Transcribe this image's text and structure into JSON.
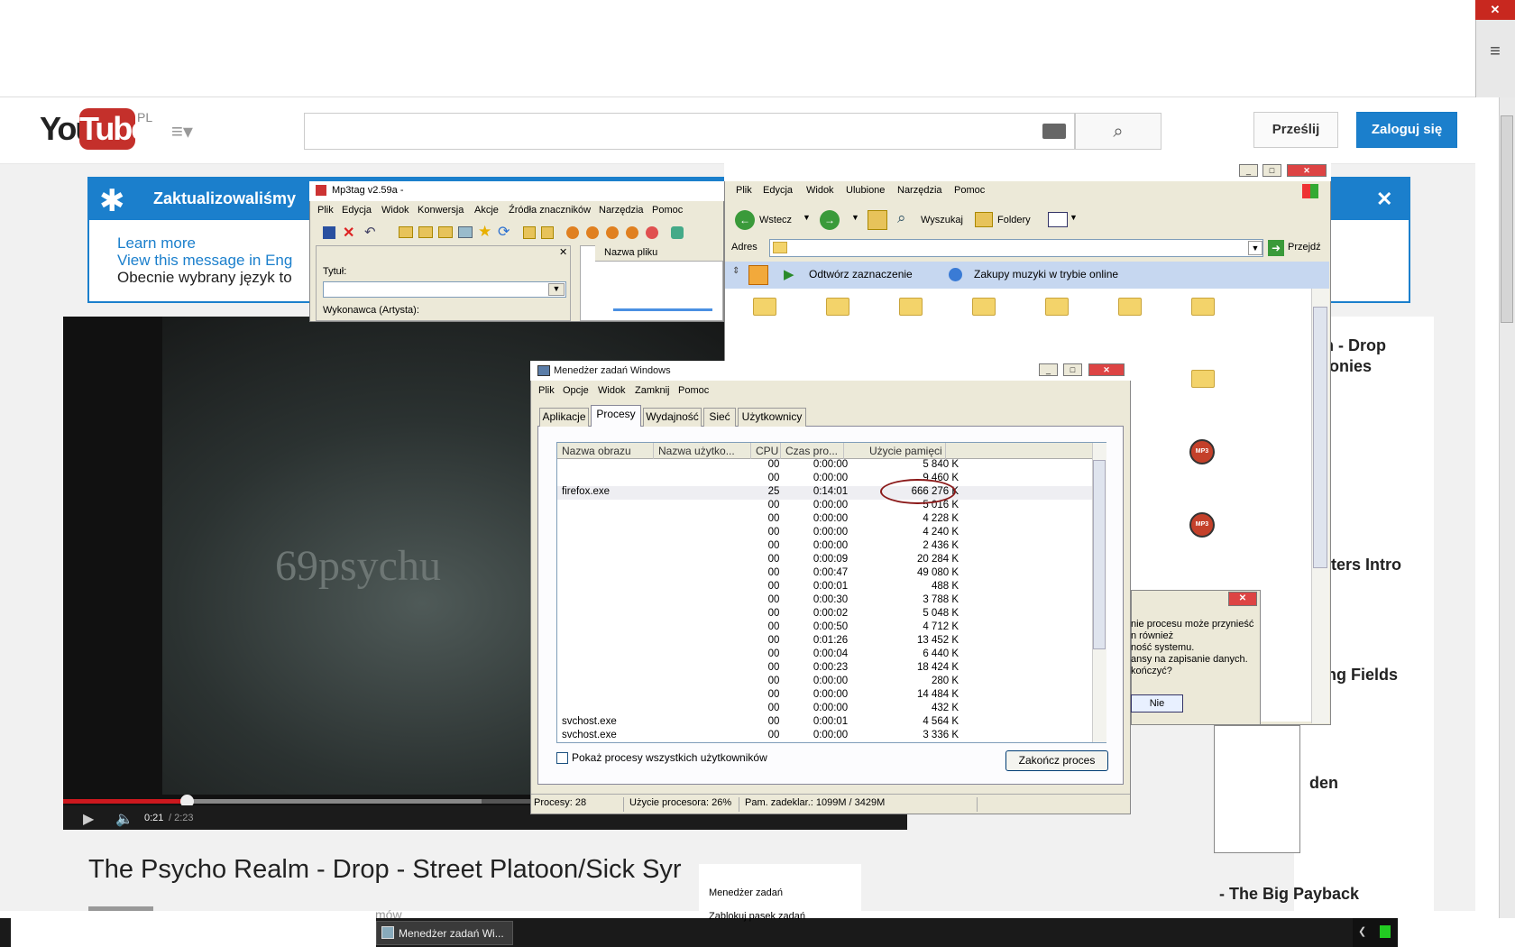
{
  "browser": {
    "close_label": "✕",
    "menu_icon": "hamburger-icon"
  },
  "youtube": {
    "logo_you": "You",
    "logo_tube": "Tube",
    "logo_region": "PL",
    "search_placeholder": "",
    "upload_label": "Prześlij",
    "login_label": "Zaloguj się",
    "banner": {
      "title": "Zaktualizowaliśmy",
      "learn_more": "Learn more",
      "view_message": "View this message in Eng",
      "current_language": "Obecnie wybrany język to"
    },
    "player": {
      "watermark": "69psychu",
      "time_current": "0:21",
      "time_duration": " / 2:23",
      "progress_fraction": 0.147
    },
    "video_title": "The Psycho Realm - Drop - Street Platoon/Sick Syr",
    "views_fragment": "mów",
    "sidebar_titles": [
      "alm - Drop",
      "onies",
      "tters Intro",
      "ing Fields",
      "den",
      "- The Big Payback"
    ]
  },
  "mp3tag": {
    "title": "Mp3tag v2.59a -",
    "menu": [
      "Plik",
      "Edycja",
      "Widok",
      "Konwersja",
      "Akcje",
      "Źródła znaczników",
      "Narzędzia",
      "Pomoc"
    ],
    "field_title": "Tytuł:",
    "field_artist": "Wykonawca (Artysta):",
    "col_filename": "Nazwa pliku"
  },
  "explorer": {
    "menu": [
      "Plik",
      "Edycja",
      "Widok",
      "Ulubione",
      "Narzędzia",
      "Pomoc"
    ],
    "back_label": "Wstecz",
    "search_label": "Wyszukaj",
    "folders_label": "Foldery",
    "address_label": "Adres",
    "go_label": "Przejdź",
    "play_selection": "Odtwórz zaznaczenie",
    "buy_music": "Zakupy muzyki w trybie online",
    "mp3_badge": "MP3"
  },
  "dialog": {
    "lines": [
      "nie procesu może przynieść",
      "n również",
      "ność systemu.",
      "ansy na zapisanie danych.",
      "kończyć?"
    ],
    "no_label": "Nie"
  },
  "taskmgr": {
    "title": "Menedżer zadań Windows",
    "menu": [
      "Plik",
      "Opcje",
      "Widok",
      "Zamknij",
      "Pomoc"
    ],
    "tabs": [
      "Aplikacje",
      "Procesy",
      "Wydajność",
      "Sieć",
      "Użytkownicy"
    ],
    "columns": [
      "Nazwa obrazu",
      "Nazwa użytko...",
      "CPU",
      "Czas pro...",
      "Użycie pamięci"
    ],
    "rows": [
      {
        "name": "",
        "cpu": "00",
        "time": "0:00:00",
        "mem": "5 840 K"
      },
      {
        "name": "",
        "cpu": "00",
        "time": "0:00:00",
        "mem": "9 460 K"
      },
      {
        "name": "firefox.exe",
        "cpu": "25",
        "time": "0:14:01",
        "mem": "666 276 K"
      },
      {
        "name": "",
        "cpu": "00",
        "time": "0:00:00",
        "mem": "5 016 K"
      },
      {
        "name": "",
        "cpu": "00",
        "time": "0:00:00",
        "mem": "4 228 K"
      },
      {
        "name": "",
        "cpu": "00",
        "time": "0:00:00",
        "mem": "4 240 K"
      },
      {
        "name": "",
        "cpu": "00",
        "time": "0:00:00",
        "mem": "2 436 K"
      },
      {
        "name": "",
        "cpu": "00",
        "time": "0:00:09",
        "mem": "20 284 K"
      },
      {
        "name": "",
        "cpu": "00",
        "time": "0:00:47",
        "mem": "49 080 K"
      },
      {
        "name": "",
        "cpu": "00",
        "time": "0:00:01",
        "mem": "488 K"
      },
      {
        "name": "",
        "cpu": "00",
        "time": "0:00:30",
        "mem": "3 788 K"
      },
      {
        "name": "",
        "cpu": "00",
        "time": "0:00:02",
        "mem": "5 048 K"
      },
      {
        "name": "",
        "cpu": "00",
        "time": "0:00:50",
        "mem": "4 712 K"
      },
      {
        "name": "",
        "cpu": "00",
        "time": "0:01:26",
        "mem": "13 452 K"
      },
      {
        "name": "",
        "cpu": "00",
        "time": "0:00:04",
        "mem": "6 440 K"
      },
      {
        "name": "",
        "cpu": "00",
        "time": "0:00:23",
        "mem": "18 424 K"
      },
      {
        "name": "",
        "cpu": "00",
        "time": "0:00:00",
        "mem": "280 K"
      },
      {
        "name": "",
        "cpu": "00",
        "time": "0:00:00",
        "mem": "14 484 K"
      },
      {
        "name": "",
        "cpu": "00",
        "time": "0:00:00",
        "mem": "432 K"
      },
      {
        "name": "svchost.exe",
        "cpu": "00",
        "time": "0:00:01",
        "mem": "4 564 K"
      },
      {
        "name": "svchost.exe",
        "cpu": "00",
        "time": "0:00:00",
        "mem": "3 336 K"
      }
    ],
    "show_all_label": "Pokaż procesy wszystkich użytkowników",
    "end_process_label": "Zakończ proces",
    "status_processes": "Procesy: 28",
    "status_cpu": "Użycie procesora: 26%",
    "status_mem": "Pam. zadeklar.: 1099M / 3429M"
  },
  "taskbar": {
    "task_label": "Menedżer zadań Wi...",
    "context_item1": "Menedżer zadań",
    "context_item2": "Zablokuj pasek zadań"
  }
}
